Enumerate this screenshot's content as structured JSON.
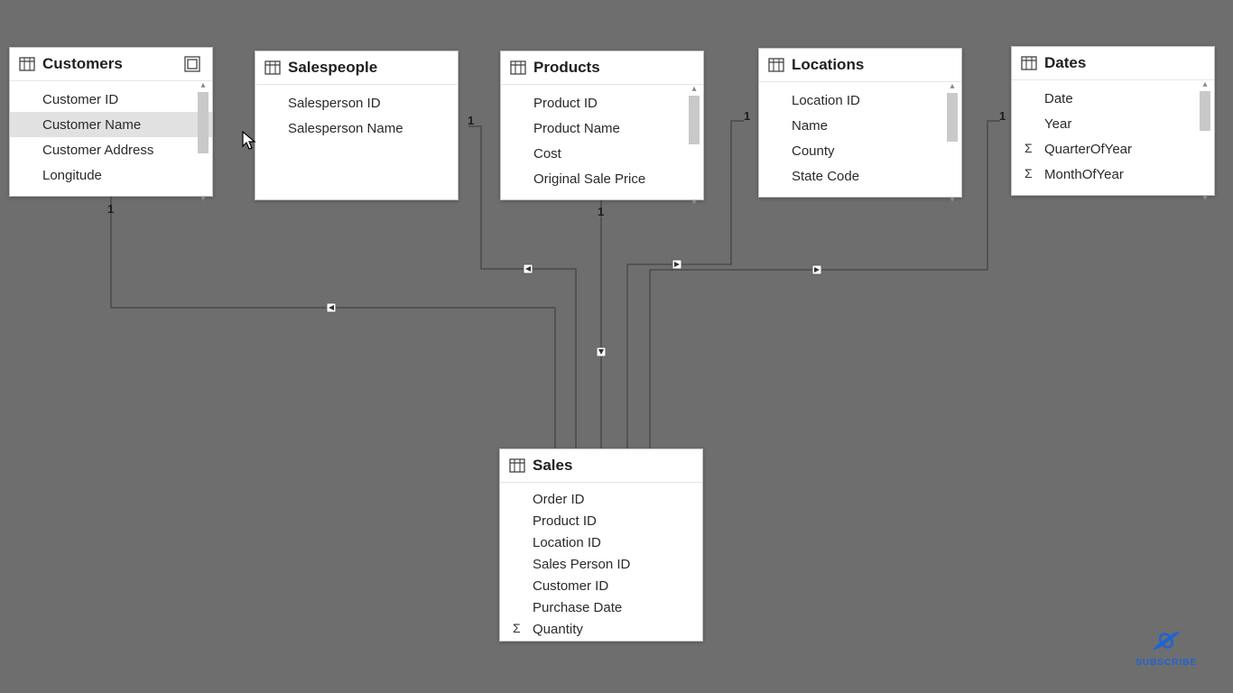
{
  "tables": {
    "customers": {
      "title": "Customers",
      "fields": [
        "Customer ID",
        "Customer Name",
        "Customer Address",
        "Longitude"
      ]
    },
    "salespeople": {
      "title": "Salespeople",
      "fields": [
        "Salesperson ID",
        "Salesperson Name"
      ]
    },
    "products": {
      "title": "Products",
      "fields": [
        "Product ID",
        "Product Name",
        "Cost",
        "Original Sale Price"
      ]
    },
    "locations": {
      "title": "Locations",
      "fields": [
        "Location ID",
        "Name",
        "County",
        "State Code"
      ]
    },
    "dates": {
      "title": "Dates",
      "fields": [
        "Date",
        "Year",
        "QuarterOfYear",
        "MonthOfYear"
      ]
    },
    "sales": {
      "title": "Sales",
      "fields": [
        "Order ID",
        "Product ID",
        "Location ID",
        "Sales Person ID",
        "Customer ID",
        "Purchase Date",
        "Quantity"
      ]
    }
  },
  "cardinality": {
    "customers": "1",
    "salespeople": "1",
    "products": "1",
    "locations": "1",
    "dates": "1"
  },
  "subscribe_label": "SUBSCRIBE"
}
